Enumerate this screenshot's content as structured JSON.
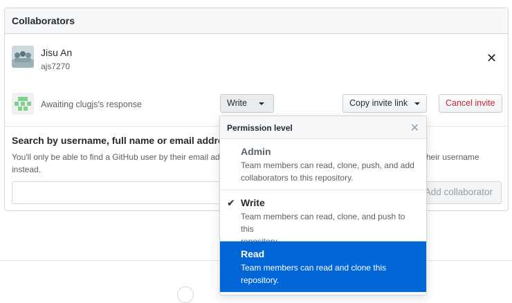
{
  "panel": {
    "title": "Collaborators"
  },
  "collaborator": {
    "name": "Jisu An",
    "login": "ajs7270"
  },
  "invite": {
    "status_text": "Awaiting clugjs's response",
    "permission_label": "Write",
    "copy_link_label": "Copy invite link",
    "cancel_label": "Cancel invite"
  },
  "search": {
    "title": "Search by username, full name or email address",
    "note_line1": "You'll only be able to find a GitHub user by their email address if they've chosen to list it publicly. Otherwise, use their username",
    "note_line2": "instead.",
    "input_value": "",
    "add_label": "Add collaborator"
  },
  "dropdown": {
    "header": "Permission level",
    "options": [
      {
        "title": "Admin",
        "desc_line1": "Team members can read, clone, push, and add",
        "desc_line2": "collaborators to this repository."
      },
      {
        "title": "Write",
        "desc_line1": "Team members can read, clone, and push to this",
        "desc_line2": "repository."
      },
      {
        "title": "Read",
        "desc_line1": "Team members can read and clone this",
        "desc_line2": "repository."
      }
    ],
    "checked_option": "Write",
    "highlighted_option": "Read"
  },
  "colors": {
    "accent": "#0366d6",
    "danger": "#cb2431",
    "identicon": "#7fd08a"
  }
}
